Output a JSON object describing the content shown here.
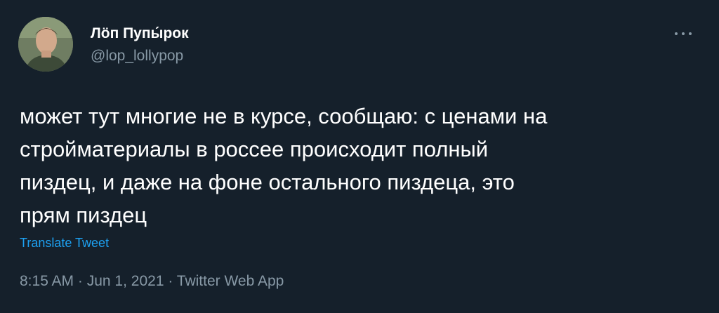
{
  "author": {
    "display_name": "Лӧп Пупы́рок",
    "handle": "@lop_lollypop",
    "avatar_icon": "user-avatar-photo"
  },
  "more_icon": "more-horizontal-icon",
  "tweet": {
    "text": "может тут многие не в курсе, сообщаю: с ценами на\nстройматериалы в россее происходит полный\nпиздец, и даже на фоне остального пиздеца, это\nпрям пиздец",
    "translate_label": "Translate Tweet"
  },
  "meta": {
    "time": "8:15 AM",
    "separator": " · ",
    "date": "Jun 1, 2021",
    "source": "Twitter Web App"
  },
  "colors": {
    "background": "#15202b",
    "primary_text": "#ffffff",
    "secondary_text": "#8899a6",
    "link": "#1da1f2"
  }
}
